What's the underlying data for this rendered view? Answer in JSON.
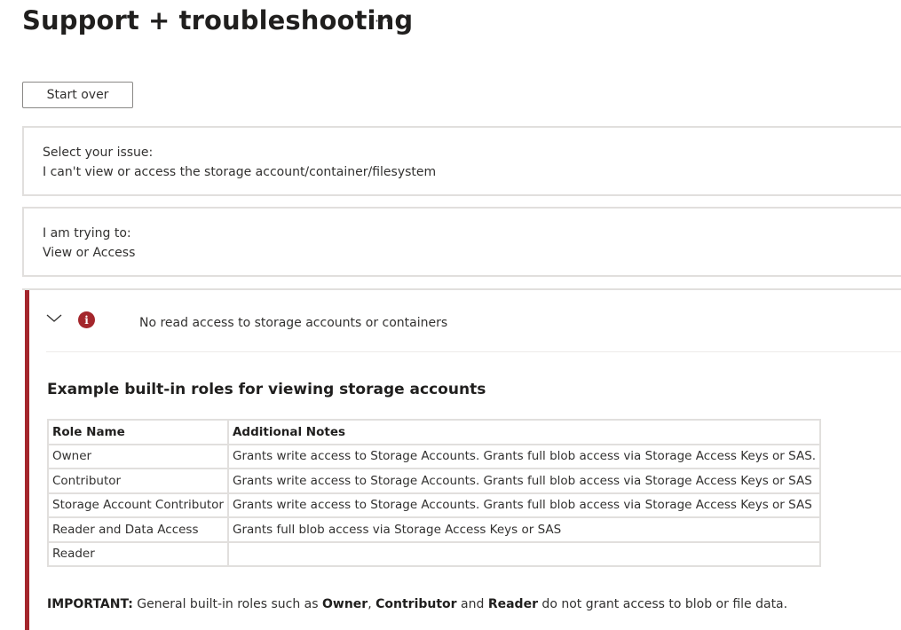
{
  "header": {
    "title": "Support + troubleshooting",
    "more_label": "···"
  },
  "toolbar": {
    "start_over_label": "Start over"
  },
  "issue_card": {
    "label": "Select your issue:",
    "value": "I can't view or access the storage account/container/filesystem"
  },
  "trying_card": {
    "label": "I am trying to:",
    "value": "View or Access"
  },
  "result": {
    "title": "No read access to storage accounts or containers",
    "accent_color": "#a4262c",
    "icons": [
      "chevron-down-icon",
      "error-info-icon"
    ],
    "section_heading": "Example built-in roles for viewing storage accounts",
    "table": {
      "headers": [
        "Role Name",
        "Additional Notes"
      ],
      "rows": [
        [
          "Owner",
          "Grants write access to Storage Accounts. Grants full blob access via Storage Access Keys or SAS."
        ],
        [
          "Contributor",
          "Grants write access to Storage Accounts. Grants full blob access via Storage Access Keys or SAS"
        ],
        [
          "Storage Account Contributor",
          "Grants write access to Storage Accounts. Grants full blob access via Storage Access Keys or SAS"
        ],
        [
          "Reader and Data Access",
          "Grants full blob access via Storage Access Keys or SAS"
        ],
        [
          "Reader",
          ""
        ]
      ]
    },
    "note": {
      "lead": "IMPORTANT:",
      "text1": " General built-in roles such as ",
      "role1": "Owner",
      "sep1": ", ",
      "role2": "Contributor",
      "sep2": " and ",
      "role3": "Reader",
      "text2": " do not grant access to blob or file data."
    }
  }
}
